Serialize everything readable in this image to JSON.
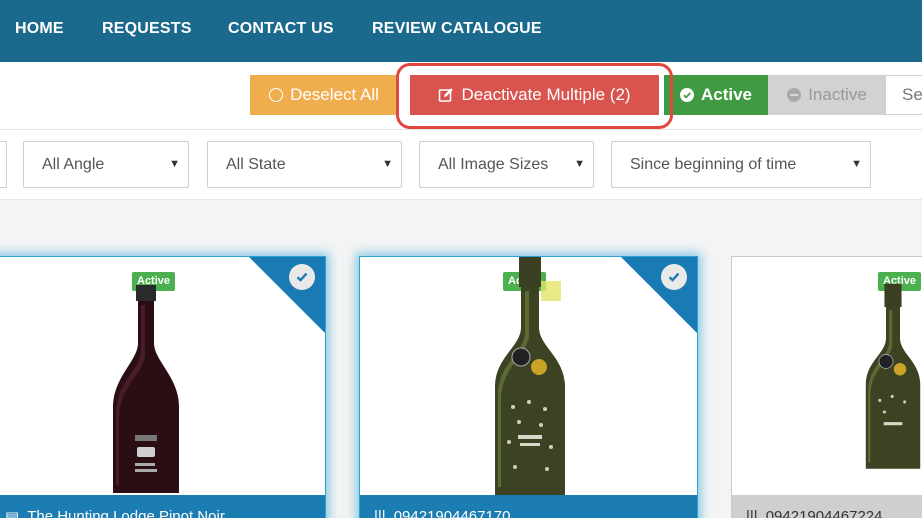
{
  "nav": {
    "items": [
      {
        "label": "HOME"
      },
      {
        "label": "REQUESTS"
      },
      {
        "label": "CONTACT US"
      },
      {
        "label": "REVIEW CATALOGUE"
      }
    ]
  },
  "toolbar": {
    "deselect_label": "Deselect All",
    "deactivate_label": "Deactivate Multiple (2)",
    "active_label": "Active",
    "inactive_label": "Inactive",
    "search_text": "Se"
  },
  "filters": {
    "angle": "All Angle",
    "state": "All State",
    "image_size": "All Image Sizes",
    "date_range": "Since beginning of time"
  },
  "cards": [
    {
      "badge": "Active",
      "caption": "The Hunting Lodge Pinot Noir",
      "caption_icon": "document-icon",
      "selected": true,
      "bottle": "dark-red"
    },
    {
      "badge": "Active",
      "caption": "09421904467170",
      "caption_icon": "barcode-icon",
      "selected": true,
      "bottle": "green"
    },
    {
      "badge": "Active",
      "caption": "09421904467224",
      "caption_icon": "barcode-icon",
      "selected": false,
      "bottle": "green"
    }
  ],
  "colors": {
    "nav_bg": "#1b6a8e",
    "deselect": "#f0ad4e",
    "deactivate": "#d9534f",
    "active": "#3f9a41",
    "inactive": "#d2d2d2",
    "badge": "#4caf50",
    "selected_corner": "#1a7ab3",
    "highlight_ring": "#e1473f"
  }
}
